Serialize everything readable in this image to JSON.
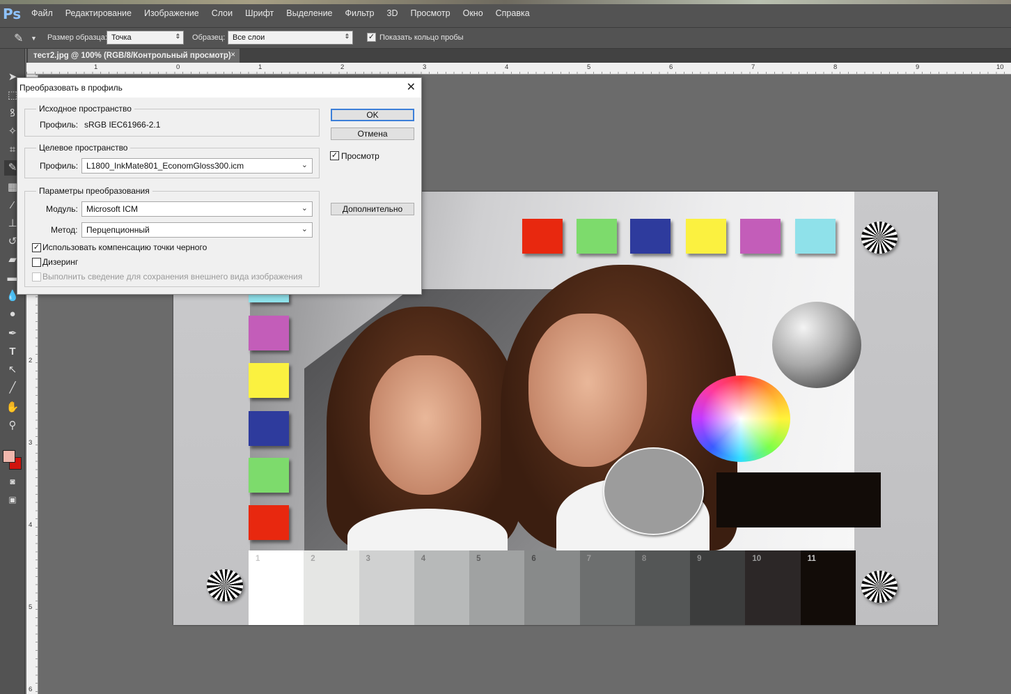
{
  "menubar": {
    "logo": "Ps",
    "items": [
      "Файл",
      "Редактирование",
      "Изображение",
      "Слои",
      "Шрифт",
      "Выделение",
      "Фильтр",
      "3D",
      "Просмотр",
      "Окно",
      "Справка"
    ]
  },
  "options": {
    "sample_size_label": "Размер образца:",
    "sample_size_value": "Точка",
    "sample_label": "Образец:",
    "sample_value": "Все слои",
    "show_ring_label": "Показать кольцо пробы",
    "show_ring_checked": true
  },
  "document_tab": {
    "title": "тест2.jpg @ 100% (RGB/8/Контрольный просмотр)",
    "close": "×"
  },
  "ruler": {
    "h_numbers": [
      "1",
      "0",
      "1",
      "2",
      "3",
      "4",
      "5",
      "6",
      "7",
      "8",
      "9",
      "10"
    ],
    "v_numbers": [
      "2",
      "3",
      "4",
      "5",
      "6"
    ]
  },
  "dialog": {
    "title": "Преобразовать в профиль",
    "close": "✕",
    "source": {
      "legend": "Исходное пространство",
      "profile_label": "Профиль:",
      "profile_value": "sRGB IEC61966-2.1"
    },
    "target": {
      "legend": "Целевое пространство",
      "profile_label": "Профиль:",
      "profile_value": "L1800_InkMate801_EconomGloss300.icm"
    },
    "conversion": {
      "legend": "Параметры преобразования",
      "module_label": "Модуль:",
      "module_value": "Microsoft ICM",
      "method_label": "Метод:",
      "method_value": "Перцепционный",
      "black_point_label": "Использовать компенсацию точки черного",
      "black_point_checked": true,
      "dither_label": "Дизеринг",
      "dither_checked": false,
      "flatten_label": "Выполнить сведение для сохранения внешнего вида изображения",
      "flatten_checked": false
    },
    "ok": "OK",
    "cancel": "Отмена",
    "preview_label": "Просмотр",
    "preview_checked": true,
    "advanced": "Дополнительно"
  },
  "test_image": {
    "gray_scale_labels": [
      "1",
      "2",
      "3",
      "4",
      "5",
      "6",
      "7",
      "8",
      "9",
      "10",
      "11"
    ],
    "gray_scale_colors": [
      "#ffffff",
      "#e5e6e4",
      "#d0d1d1",
      "#b7b9b9",
      "#a0a2a2",
      "#888a8a",
      "#6d6f6f",
      "#545656",
      "#3c3d3d",
      "#2c2727",
      "#120c08"
    ],
    "top_squares": [
      "#e8280f",
      "#7ddb6c",
      "#2e3b9d",
      "#fbf140",
      "#c35db9",
      "#8fe1ea"
    ],
    "left_squares": [
      "#c35db9",
      "#fbf140",
      "#2e3b9d",
      "#7ddb6c",
      "#e8280f"
    ]
  },
  "colors": {
    "fg": "#f1b7ad",
    "bg": "#d0140e",
    "accent": "#3c7fd9"
  }
}
